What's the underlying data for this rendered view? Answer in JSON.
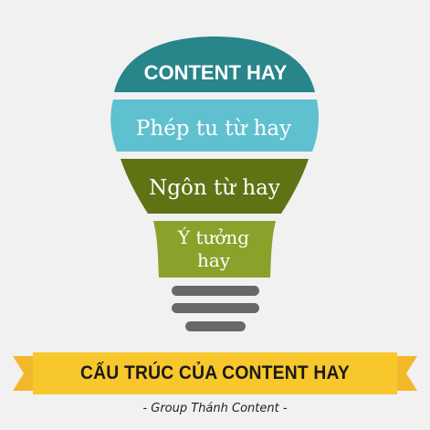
{
  "diagram": {
    "layers": [
      {
        "id": "content-hay",
        "label": "CONTENT HAY",
        "color": "#28858a"
      },
      {
        "id": "phep-tu-tu-hay",
        "label": "Phép tu từ hay",
        "color": "#5fc1d0"
      },
      {
        "id": "ngon-tu-hay",
        "label": "Ngôn từ hay",
        "color": "#5e7414"
      },
      {
        "id": "y-tuong-hay",
        "label_line1": "Ý tưởng",
        "label_line2": "hay",
        "color": "#8aa22a"
      }
    ],
    "base_stripes_color": "#686868",
    "banner": {
      "text": "CẤU TRÚC CỦA CONTENT HAY",
      "color": "#f7c72b",
      "accent_color": "#f2b82a"
    },
    "footer": "- Group Thánh Content -"
  }
}
